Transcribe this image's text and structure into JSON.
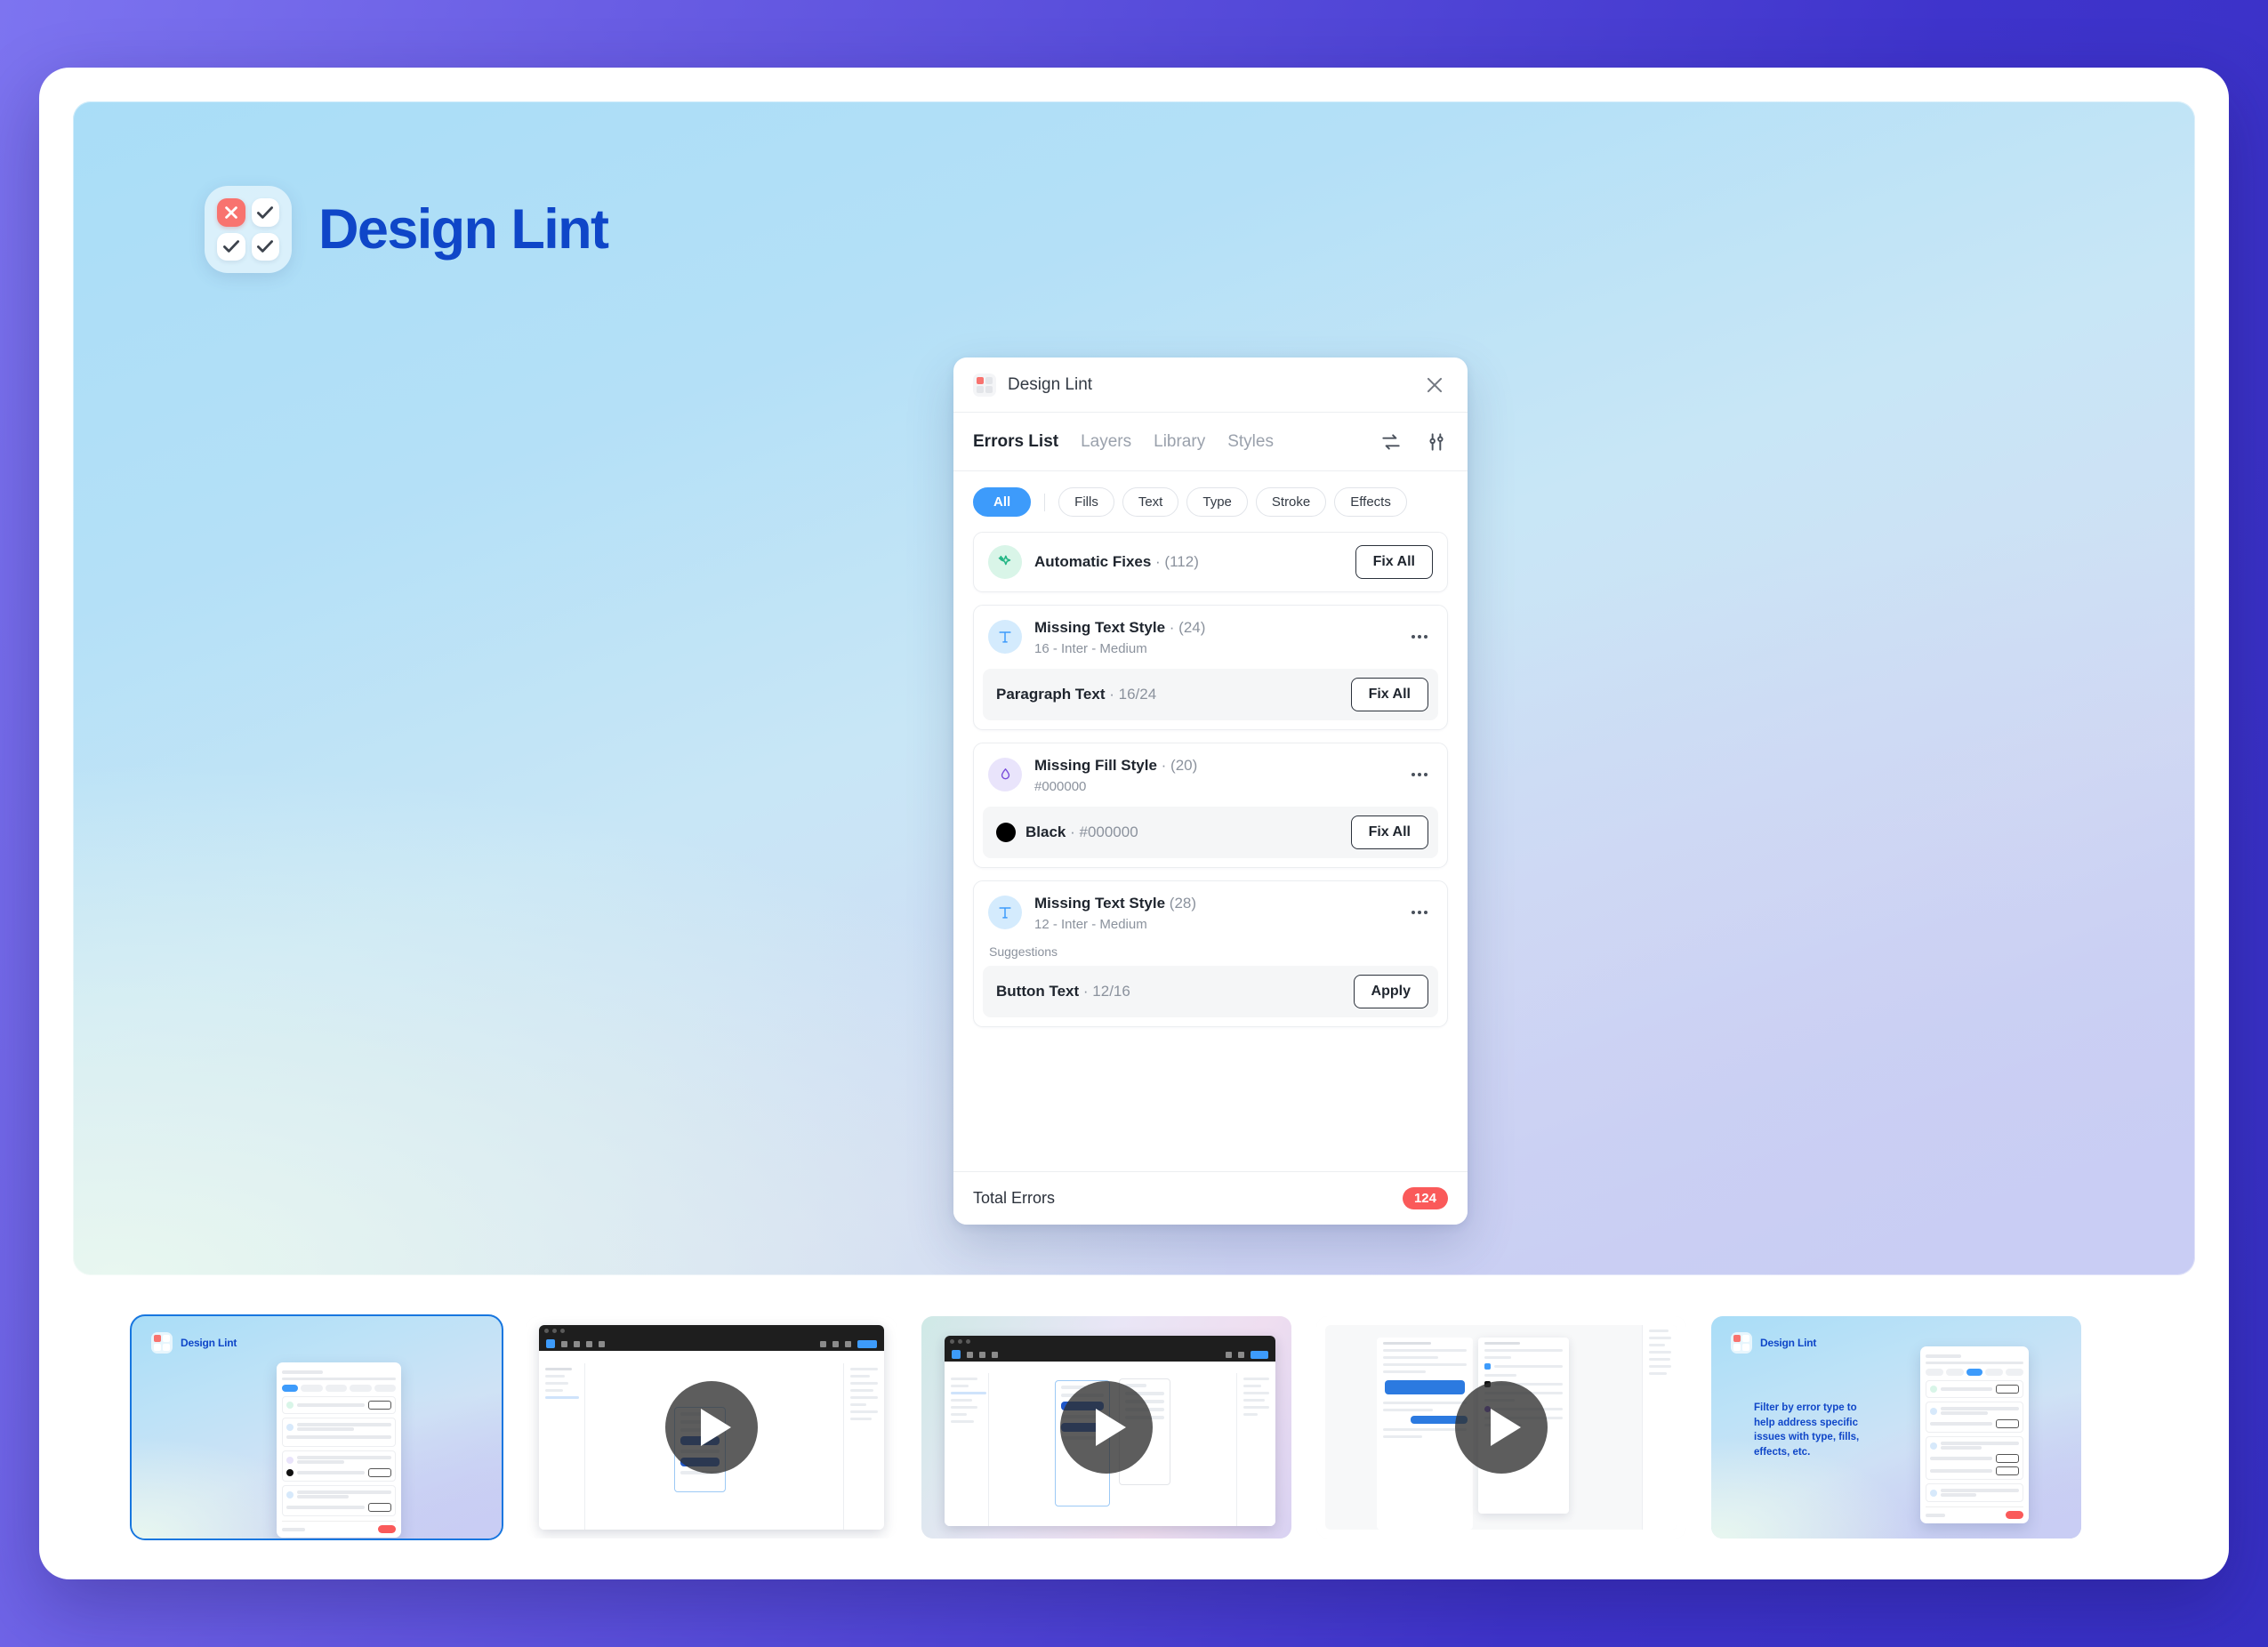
{
  "brand": {
    "title": "Design Lint",
    "logo_icon": "lint-grid-logo-icon",
    "title_color": "#0f46c8"
  },
  "plugin": {
    "app_icon": "design-lint-app-icon",
    "title": "Design Lint",
    "close_icon": "close-icon",
    "tabs": [
      {
        "label": "Errors List",
        "active": true
      },
      {
        "label": "Layers",
        "active": false
      },
      {
        "label": "Library",
        "active": false
      },
      {
        "label": "Styles",
        "active": false
      }
    ],
    "toolbar_icons": [
      {
        "name": "refresh-swap-icon"
      },
      {
        "name": "settings-sliders-icon"
      }
    ],
    "filters": [
      {
        "label": "All",
        "active": true
      },
      {
        "label": "Fills",
        "active": false
      },
      {
        "label": "Text",
        "active": false
      },
      {
        "label": "Type",
        "active": false
      },
      {
        "label": "Stroke",
        "active": false
      },
      {
        "label": "Effects",
        "active": false
      }
    ],
    "groups": [
      {
        "icon": "sparkle-auto-fix-icon",
        "icon_tone": "green",
        "title": "Automatic Fixes",
        "count": "· (112)",
        "subtitle": "",
        "action_label": "Fix All",
        "has_kebab": false,
        "suggestions_label": "",
        "items": []
      },
      {
        "icon": "text-style-icon",
        "icon_tone": "blue",
        "title": "Missing Text Style",
        "count": "· (24)",
        "subtitle": "16 - Inter - Medium",
        "action_label": "",
        "has_kebab": true,
        "suggestions_label": "",
        "items": [
          {
            "name": "Paragraph Text",
            "value": "· 16/24",
            "swatch": "",
            "action_label": "Fix All"
          }
        ]
      },
      {
        "icon": "fill-drop-icon",
        "icon_tone": "purple",
        "title": "Missing Fill Style",
        "count": "· (20)",
        "subtitle": "#000000",
        "action_label": "",
        "has_kebab": true,
        "suggestions_label": "",
        "items": [
          {
            "name": "Black",
            "value": "· #000000",
            "swatch": "#000000",
            "action_label": "Fix All"
          }
        ]
      },
      {
        "icon": "text-style-icon",
        "icon_tone": "blue",
        "title": "Missing Text Style",
        "count": "(28)",
        "subtitle": "12 - Inter - Medium",
        "action_label": "",
        "has_kebab": true,
        "suggestions_label": "Suggestions",
        "items": [
          {
            "name": "Button Text",
            "value": "· 12/16",
            "swatch": "",
            "action_label": "Apply"
          }
        ]
      }
    ],
    "footer": {
      "label": "Total Errors",
      "badge": "124",
      "badge_color": "#fa5a5a"
    }
  },
  "thumbnails": [
    {
      "name": "thumbnail-cover",
      "type": "image",
      "selected": true,
      "brand_title": "Design Lint",
      "caption": ""
    },
    {
      "name": "thumbnail-video-1",
      "type": "video",
      "selected": false,
      "brand_title": "",
      "caption": "",
      "play_icon": "play-icon"
    },
    {
      "name": "thumbnail-video-2",
      "type": "video",
      "selected": false,
      "brand_title": "",
      "caption": "",
      "play_icon": "play-icon"
    },
    {
      "name": "thumbnail-video-3",
      "type": "video",
      "selected": false,
      "brand_title": "",
      "caption": "",
      "play_icon": "play-icon"
    },
    {
      "name": "thumbnail-feature",
      "type": "image",
      "selected": false,
      "brand_title": "Design Lint",
      "caption": "Filter by error type to help address specific issues with type, fills, effects, etc."
    }
  ]
}
